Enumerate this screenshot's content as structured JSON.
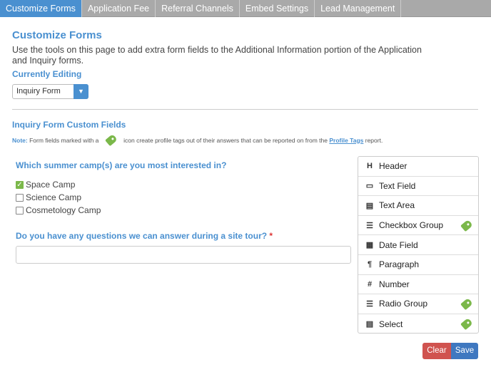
{
  "tabs": [
    {
      "label": "Customize Forms",
      "active": true
    },
    {
      "label": "Application Fee"
    },
    {
      "label": "Referral Channels"
    },
    {
      "label": "Embed Settings"
    },
    {
      "label": "Lead Management"
    }
  ],
  "title": "Customize Forms",
  "description": "Use the tools on this page to add extra form fields to the Additional Information portion of the Application and Inquiry forms.",
  "currently_editing_label": "Currently Editing",
  "form_select": {
    "value": "Inquiry Form"
  },
  "section_title": "Inquiry Form Custom Fields",
  "note": {
    "label": "Note:",
    "text1": " Form fields marked with a ",
    "text2": " icon create profile tags out of their answers that can be reported on from the ",
    "link": "Profile Tags",
    "text3": " report."
  },
  "questions": [
    {
      "label": "Which summer camp(s) are you most interested in?",
      "options": [
        {
          "label": "Space Camp",
          "checked": true
        },
        {
          "label": "Science Camp",
          "checked": false
        },
        {
          "label": "Cosmetology Camp",
          "checked": false
        }
      ]
    },
    {
      "label": "Do you have any questions we can answer during a site tour?",
      "required": "*",
      "value": ""
    }
  ],
  "field_types": [
    {
      "label": "Header",
      "icon": "H",
      "tag": false
    },
    {
      "label": "Text Field",
      "icon": "▭",
      "tag": false
    },
    {
      "label": "Text Area",
      "icon": "▤",
      "tag": false
    },
    {
      "label": "Checkbox Group",
      "icon": "☰",
      "tag": true
    },
    {
      "label": "Date Field",
      "icon": "▦",
      "tag": false
    },
    {
      "label": "Paragraph",
      "icon": "¶",
      "tag": false
    },
    {
      "label": "Number",
      "icon": "#",
      "tag": false
    },
    {
      "label": "Radio Group",
      "icon": "☰",
      "tag": true
    },
    {
      "label": "Select",
      "icon": "▤",
      "tag": true
    }
  ],
  "buttons": {
    "clear": "Clear",
    "save": "Save"
  },
  "colors": {
    "accent": "#4a90d0",
    "tag": "#7bb84a",
    "clear": "#d0534f",
    "save": "#3f78c0"
  }
}
